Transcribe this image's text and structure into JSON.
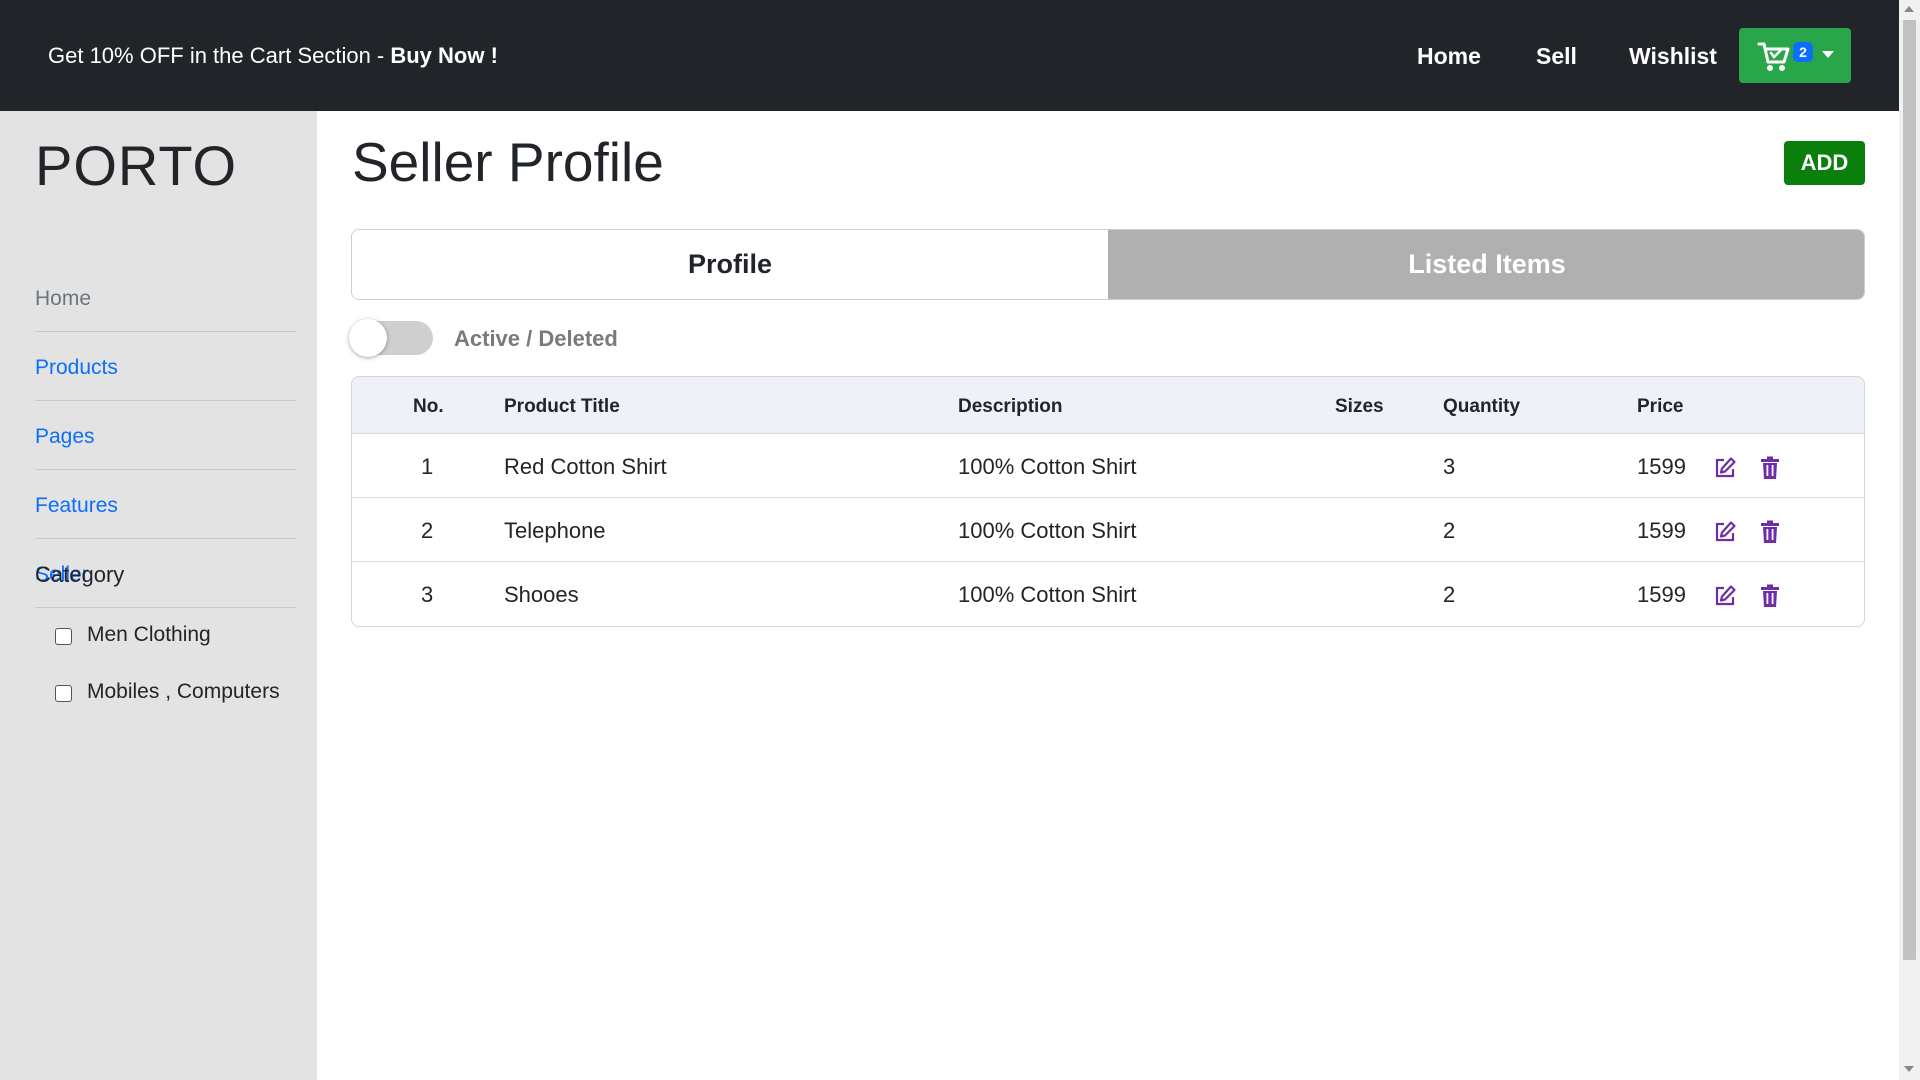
{
  "header": {
    "promo_text": "Get 10% OFF in the Cart Section - ",
    "promo_cta": "Buy Now !",
    "nav": {
      "home": "Home",
      "sell": "Sell",
      "wishlist": "Wishlist"
    },
    "cart": {
      "icon": "cart-icon",
      "count": "2",
      "color": "#2aa64a"
    }
  },
  "sidebar": {
    "brand": "PORTO",
    "items": [
      {
        "label": "Home"
      },
      {
        "label": "Products"
      },
      {
        "label": "Pages"
      },
      {
        "label": "Features"
      },
      {
        "label": "Seller"
      }
    ],
    "category": {
      "title": "Category",
      "options": [
        {
          "label": "Men Clothing",
          "checked": false
        },
        {
          "label": "Mobiles , Computers",
          "checked": false
        }
      ]
    }
  },
  "main": {
    "title": "Seller Profile",
    "add_label": "ADD",
    "tabs": [
      {
        "label": "Profile",
        "active": true
      },
      {
        "label": "Listed Items",
        "active": false
      }
    ],
    "toggle": {
      "label": "Active / Deleted",
      "on": false
    },
    "table": {
      "headers": [
        "No.",
        "Product Title",
        "Description",
        "Sizes",
        "Quantity",
        "Price"
      ],
      "rows": [
        {
          "no": "1",
          "title": "Red Cotton Shirt",
          "description": "100% Cotton Shirt",
          "sizes": "",
          "quantity": "3",
          "price": "1599"
        },
        {
          "no": "2",
          "title": "Telephone",
          "description": "100% Cotton Shirt",
          "sizes": "",
          "quantity": "2",
          "price": "1599"
        },
        {
          "no": "3",
          "title": "Shooes",
          "description": "100% Cotton Shirt",
          "sizes": "",
          "quantity": "2",
          "price": "1599"
        }
      ],
      "row_actions": [
        "edit-icon",
        "trash-icon"
      ],
      "action_color": "#6f2da8"
    }
  },
  "colors": {
    "topbar": "#212529",
    "sidebar": "#e3e3e3",
    "link": "#0d6efd",
    "add_button": "#0b7f0b",
    "inactive_tab": "#b0b0b0"
  }
}
